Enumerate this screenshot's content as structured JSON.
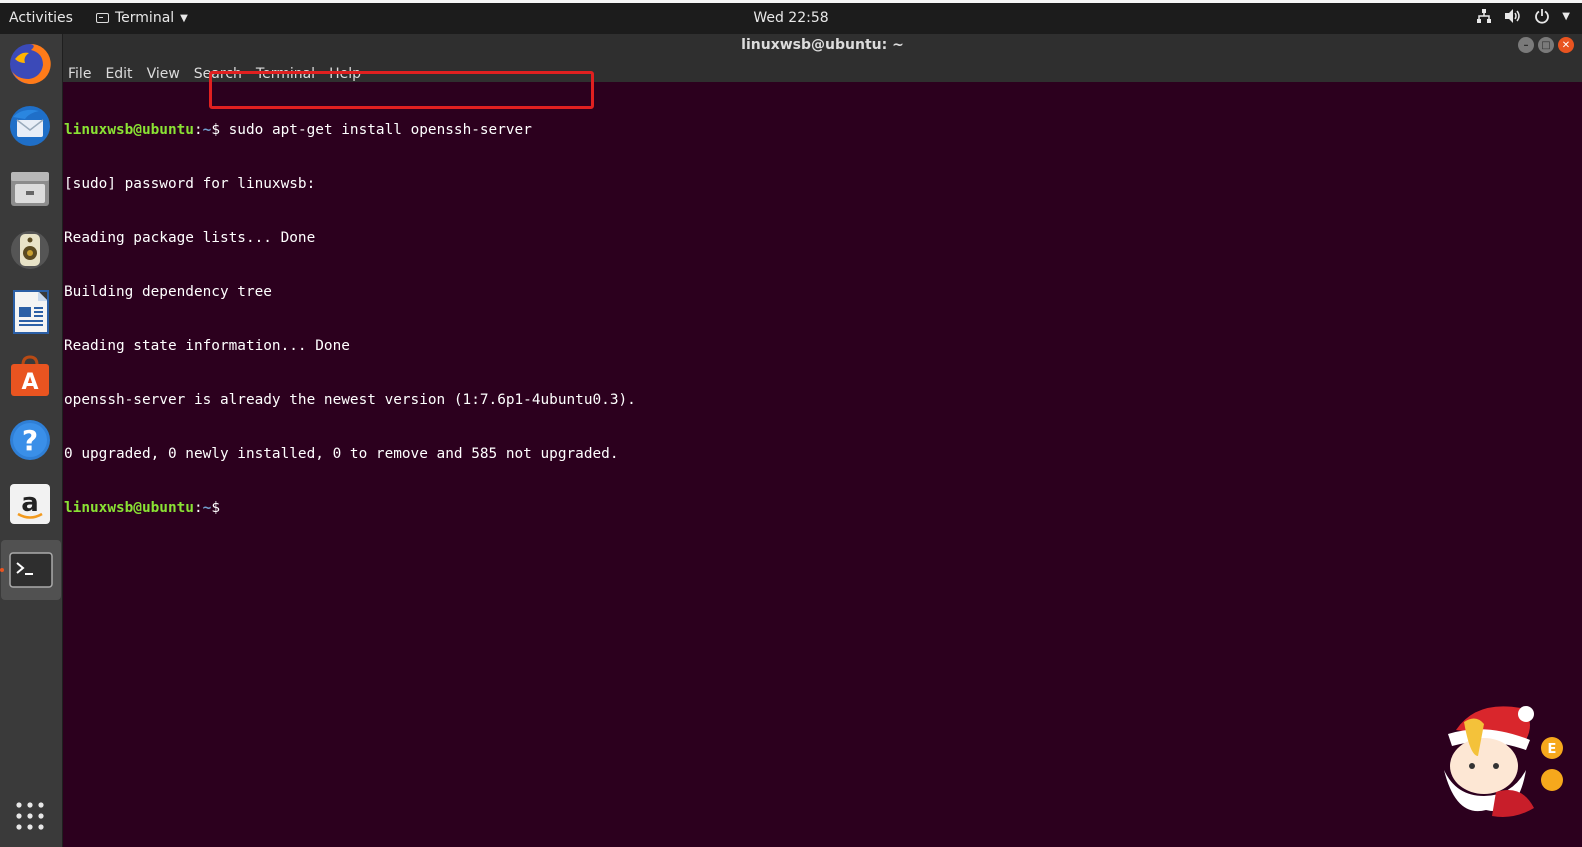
{
  "topbar": {
    "activities": "Activities",
    "app_name": "Terminal",
    "clock": "Wed 22:58"
  },
  "dock": {
    "items": [
      {
        "name": "Firefox",
        "icon": "firefox-icon"
      },
      {
        "name": "Thunderbird",
        "icon": "thunderbird-icon"
      },
      {
        "name": "Files",
        "icon": "files-icon"
      },
      {
        "name": "Rhythmbox",
        "icon": "rhythmbox-icon"
      },
      {
        "name": "LibreOffice Writer",
        "icon": "writer-icon"
      },
      {
        "name": "Ubuntu Software",
        "icon": "software-icon"
      },
      {
        "name": "Help",
        "icon": "help-icon"
      },
      {
        "name": "Amazon",
        "icon": "amazon-icon"
      },
      {
        "name": "Terminal",
        "icon": "terminal-icon"
      }
    ]
  },
  "window": {
    "title": "linuxwsb@ubuntu: ~",
    "menu": [
      "File",
      "Edit",
      "View",
      "Search",
      "Terminal",
      "Help"
    ]
  },
  "terminal": {
    "prompt_user": "linuxwsb@ubuntu",
    "prompt_sep": ":",
    "prompt_path": "~",
    "prompt_symbol": "$ ",
    "command": "sudo apt-get install openssh-server",
    "output": [
      "[sudo] password for linuxwsb:",
      "Reading package lists... Done",
      "Building dependency tree",
      "Reading state information... Done",
      "openssh-server is already the newest version (1:7.6p1-4ubuntu0.3).",
      "0 upgraded, 0 newly installed, 0 to remove and 585 not upgraded."
    ]
  },
  "colors": {
    "terminal_bg": "#2c001e",
    "prompt_user": "#8ae234",
    "prompt_path": "#729fcf",
    "highlight": "#e02020",
    "accent": "#e95420"
  }
}
